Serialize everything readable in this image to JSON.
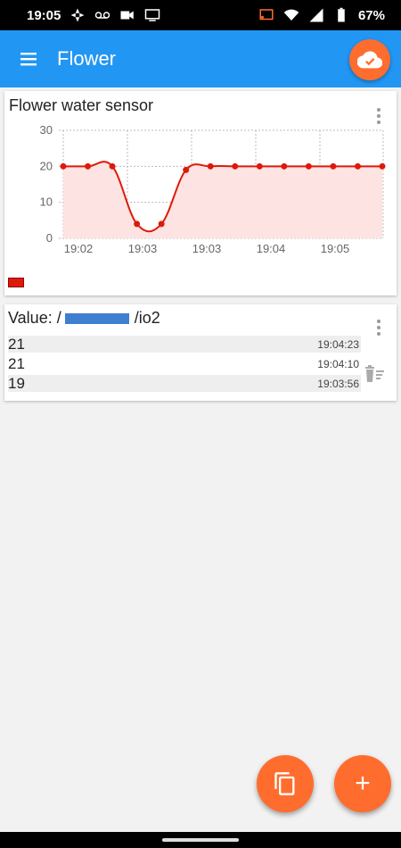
{
  "status_bar": {
    "time": "19:05",
    "battery": "67%",
    "left_icons": [
      "pinwheel-icon",
      "voicemail-icon",
      "video-icon",
      "screen-cast-icon"
    ],
    "right_icons": [
      "cast-icon",
      "wifi-icon",
      "signal-icon",
      "battery-icon"
    ]
  },
  "app_bar": {
    "title": "Flower",
    "color": "#2196f3",
    "action_icon": "cloud-done-icon",
    "accent": "#ff6d2e"
  },
  "chart_card": {
    "title": "Flower water sensor",
    "menu_icon": "more-vert-icon",
    "legend_color": "#dd1a0a"
  },
  "chart_data": {
    "type": "area",
    "title": "Flower water sensor",
    "y_ticks": [
      "30",
      "20",
      "10",
      "0"
    ],
    "x_ticks": [
      "19:02",
      "19:03",
      "19:03",
      "19:04",
      "19:05"
    ],
    "ylim": [
      0,
      30
    ],
    "grid": true,
    "legend": "bottom-left",
    "series": [
      {
        "color": "#dd1a0a",
        "fill": "#fde3e1",
        "values": [
          20,
          20,
          20,
          4,
          4,
          19,
          20,
          20,
          20,
          20,
          20,
          20,
          20,
          20
        ]
      }
    ]
  },
  "value_card": {
    "title_prefix": "Value: /",
    "title_suffix": "/io2",
    "menu_icon": "more-vert-icon",
    "clear_icon": "delete-sweep-icon",
    "rows": [
      {
        "value": "21",
        "time": "19:04:23"
      },
      {
        "value": "21",
        "time": "19:04:10"
      },
      {
        "value": "19",
        "time": "19:03:56"
      }
    ]
  },
  "fabs": {
    "copy_icon": "copy-icon",
    "add_label": "+"
  }
}
